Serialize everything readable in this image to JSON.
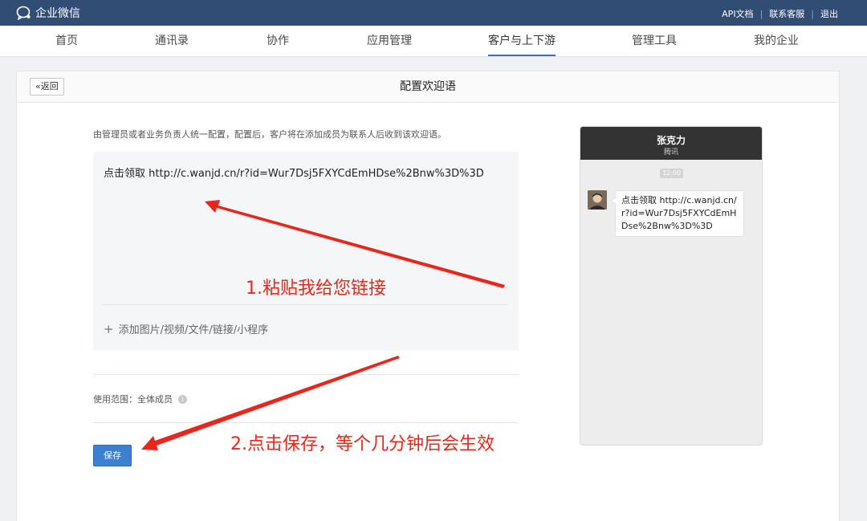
{
  "topbar": {
    "app_title": "企业微信",
    "links": [
      "API文档",
      "联系客服",
      "退出"
    ]
  },
  "nav": {
    "items": [
      {
        "label": "首页"
      },
      {
        "label": "通讯录"
      },
      {
        "label": "协作"
      },
      {
        "label": "应用管理"
      },
      {
        "label": "客户与上下游",
        "active": true
      },
      {
        "label": "管理工具"
      },
      {
        "label": "我的企业"
      }
    ]
  },
  "panel": {
    "back_label": "返回",
    "title": "配置欢迎语",
    "description": "由管理员或者业务负责人统一配置，配置后，客户将在添加成员为联系人后收到该欢迎语。",
    "message_text": "点击领取 http://c.wanjd.cn/r?id=Wur7Dsj5FXYCdEmHDse%2Bnw%3D%3D",
    "add_attachment": "添加图片/视频/文件/链接/小程序",
    "scope_label": "使用范围：",
    "scope_value": "全体成员",
    "save_label": "保存"
  },
  "preview": {
    "contact_name": "张克力",
    "contact_org": "腾讯",
    "timestamp": "12:00",
    "bubble_text": "点击领取 http://c.wanjd.cn/r?id=Wur7Dsj5FXYCdEmHDse%2Bnw%3D%3D"
  },
  "annotations": {
    "step1": "1.粘贴我给您链接",
    "step2": "2.点击保存，等个几分钟后会生效"
  },
  "colors": {
    "topbar": "#324d74",
    "accent": "#3d7fd0",
    "annotation": "#e8261c"
  }
}
